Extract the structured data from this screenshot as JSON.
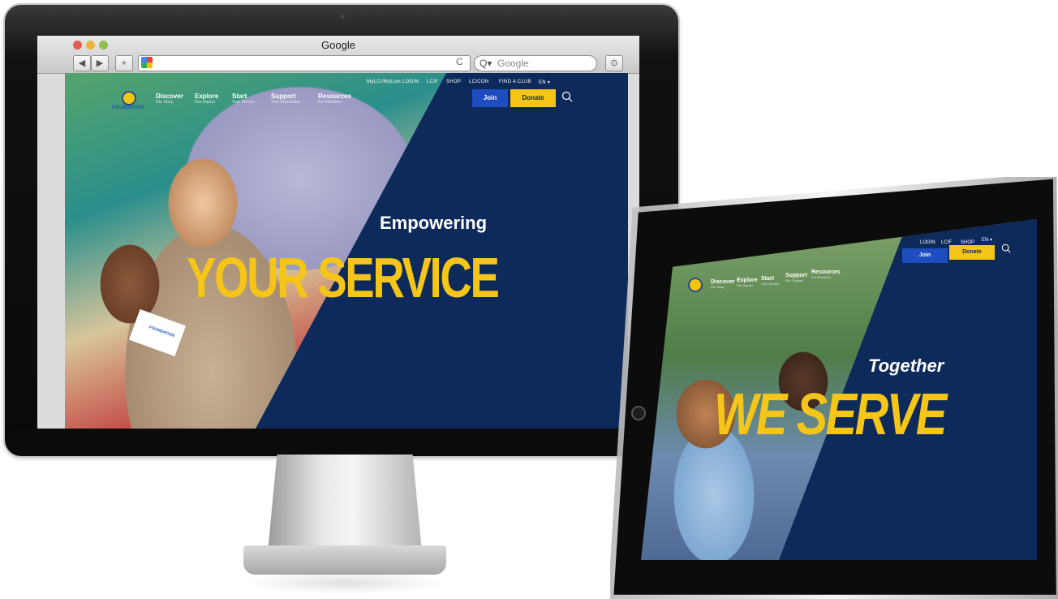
{
  "browser": {
    "window_title": "Google",
    "search_placeholder": "Google",
    "back_label": "◀",
    "forward_label": "▶",
    "new_tab_label": "+",
    "reload_label": "C",
    "download_label": "⊙"
  },
  "desktop_site": {
    "utility_links": [
      "MyLCI/MyLion LOGIN",
      "LCIF",
      "SHOP",
      "LCICON",
      "FIND A CLUB",
      "EN ▾"
    ],
    "logo_text": "FOUNDATION",
    "pamphlet_text": "FOUNDATION",
    "nav": [
      {
        "title": "Discover",
        "sub": "Our Story"
      },
      {
        "title": "Explore",
        "sub": "Our Impact"
      },
      {
        "title": "Start",
        "sub": "Your Service"
      },
      {
        "title": "Support",
        "sub": "Your Foundation"
      },
      {
        "title": "Resources",
        "sub": "For Members"
      }
    ],
    "join_label": "Join",
    "donate_label": "Donate",
    "hero_small": "Empowering",
    "hero_big": "YOUR SERVICE"
  },
  "tablet_site": {
    "utility_links": [
      "LOGIN",
      "LCIF",
      "SHOP",
      "EN ▾"
    ],
    "nav": [
      {
        "title": "Discover",
        "sub": "Our Story"
      },
      {
        "title": "Explore",
        "sub": "Our Impact"
      },
      {
        "title": "Start",
        "sub": "Your Service"
      },
      {
        "title": "Support",
        "sub": "Our Causes"
      },
      {
        "title": "Resources",
        "sub": "For Members"
      }
    ],
    "join_label": "Join",
    "donate_label": "Donate",
    "hero_small": "Together",
    "hero_big": "WE SERVE"
  },
  "colors": {
    "navy": "#0e2a5a",
    "gold": "#f5c518",
    "join_blue": "#1d4dbe"
  },
  "icons": [
    "search-icon",
    "favicon-icon",
    "reload-icon",
    "download-icon"
  ]
}
